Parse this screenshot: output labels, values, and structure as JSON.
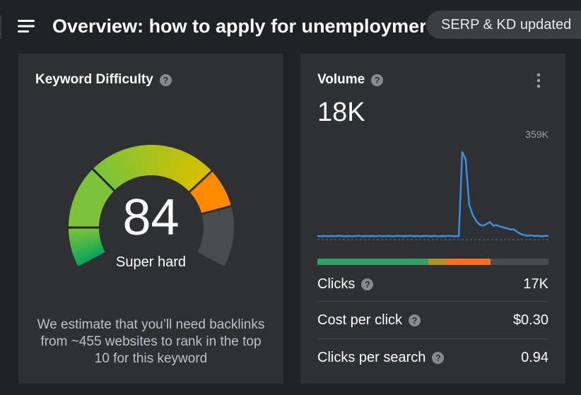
{
  "header": {
    "title": "Overview: how to apply for unemploymer",
    "status_pill": "SERP & KD updated"
  },
  "keyword_difficulty": {
    "title": "Keyword Difficulty",
    "help": "?",
    "value": "84",
    "score": 84,
    "level": "Super hard",
    "description": "We estimate that you’ll need backlinks from ~455 websites to rank in the top 10 for this keyword",
    "gauge_colors": [
      "#0aa55a",
      "#7cc33a",
      "#d8c000",
      "#ff8a00",
      "#4a4b4f"
    ]
  },
  "volume": {
    "title": "Volume",
    "help": "?",
    "value": "18K",
    "chart_max_label": "359K",
    "line_color": "#3a8ee6",
    "click_distribution": [
      {
        "share": 0.48,
        "color": "#2ea35f"
      },
      {
        "share": 0.08,
        "color": "#b09022"
      },
      {
        "share": 0.19,
        "color": "#ff6d1c"
      },
      {
        "share": 0.25,
        "color": "#4a4b4f"
      }
    ],
    "metrics": [
      {
        "label": "Clicks",
        "value": "17K",
        "help": "?"
      },
      {
        "label": "Cost per click",
        "value": "$0.30",
        "help": "?"
      },
      {
        "label": "Clicks per search",
        "value": "0.94",
        "help": "?"
      }
    ]
  },
  "chart_data": {
    "type": "line",
    "title": "",
    "xlabel": "",
    "ylabel": "",
    "ylim": [
      0,
      359000
    ],
    "series": [
      {
        "values": [
          14000,
          13000,
          14000,
          13000,
          14000,
          13000,
          15000,
          14000,
          13000,
          14000,
          13000,
          14000,
          15000,
          13000,
          14000,
          13000,
          14000,
          13000,
          15000,
          13000,
          14000,
          14000,
          13000,
          15000,
          14000,
          13000,
          14000,
          15000,
          13000,
          14000,
          13000,
          14000,
          14000,
          13000,
          14000,
          13000,
          14000,
          13000,
          15000,
          14000,
          13000,
          14000,
          350000,
          320000,
          140000,
          100000,
          75000,
          60000,
          55000,
          62000,
          70000,
          55000,
          58000,
          52000,
          48000,
          45000,
          40000,
          40000,
          30000,
          22000,
          18000,
          15000,
          17000,
          14000,
          15000,
          13000,
          15000,
          14000
        ]
      }
    ]
  }
}
